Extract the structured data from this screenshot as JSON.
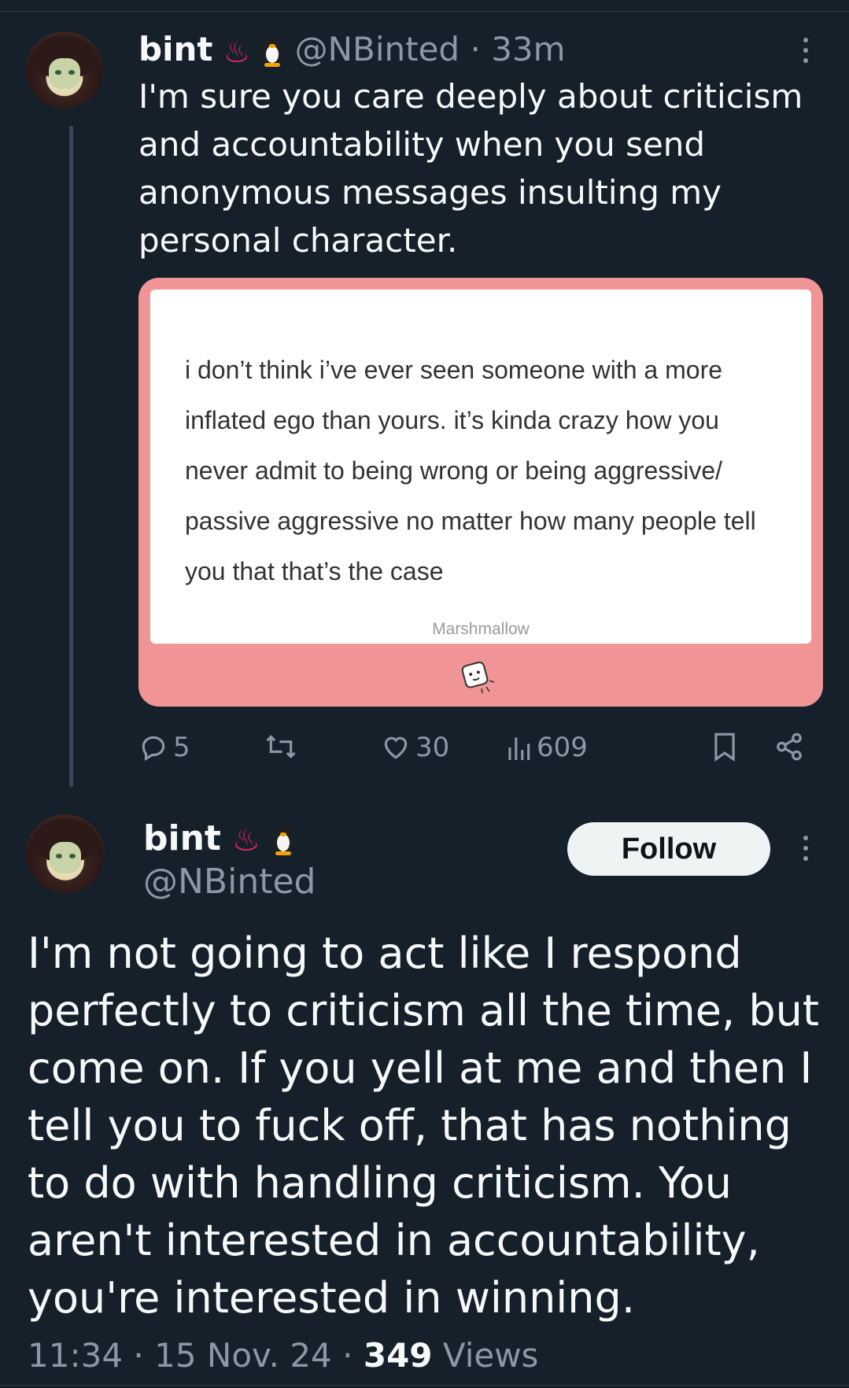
{
  "tweet1": {
    "display_name": "bint",
    "emoji_1": "♨",
    "handle": "@NBinted",
    "separator": "·",
    "time": "33m",
    "text": "I'm sure you care deeply about criticism and accountability when you send anonymous messages insulting my personal character.",
    "card": {
      "message": "i don’t think i’ve ever seen someone with a more inflated ego than yours. it’s kinda crazy how you never admit to being wrong or being aggressive/ passive aggressive no matter how many people tell you that that’s the case",
      "brand": "Marshmallow",
      "background": "#f09496"
    },
    "actions": {
      "replies": "5",
      "retweets": "",
      "likes": "30",
      "views": "609"
    }
  },
  "tweet2": {
    "display_name": "bint",
    "emoji_1": "♨",
    "handle": "@NBinted",
    "follow_label": "Follow",
    "text": "I'm not going to act like I respond perfectly to criticism all the time, but come on. If you yell at me and then I tell you to fuck off, that has nothing to do with handling criticism. You aren't interested in accountability, you're interested in winning.",
    "time": "11:34",
    "separator": "·",
    "date": "15 Nov. 24",
    "views_count": "349",
    "views_label": "Views"
  },
  "icons": {
    "reply": "reply-icon",
    "retweet": "retweet-icon",
    "like": "heart-icon",
    "views": "views-bar-chart-icon",
    "bookmark": "bookmark-icon",
    "share": "share-icon",
    "more": "more-options-icon",
    "marshmallow": "marshmallow-icon"
  },
  "colors": {
    "background": "#15202b",
    "text": "#f7f9f9",
    "muted": "#8b98a5",
    "card_pink": "#f09496"
  }
}
